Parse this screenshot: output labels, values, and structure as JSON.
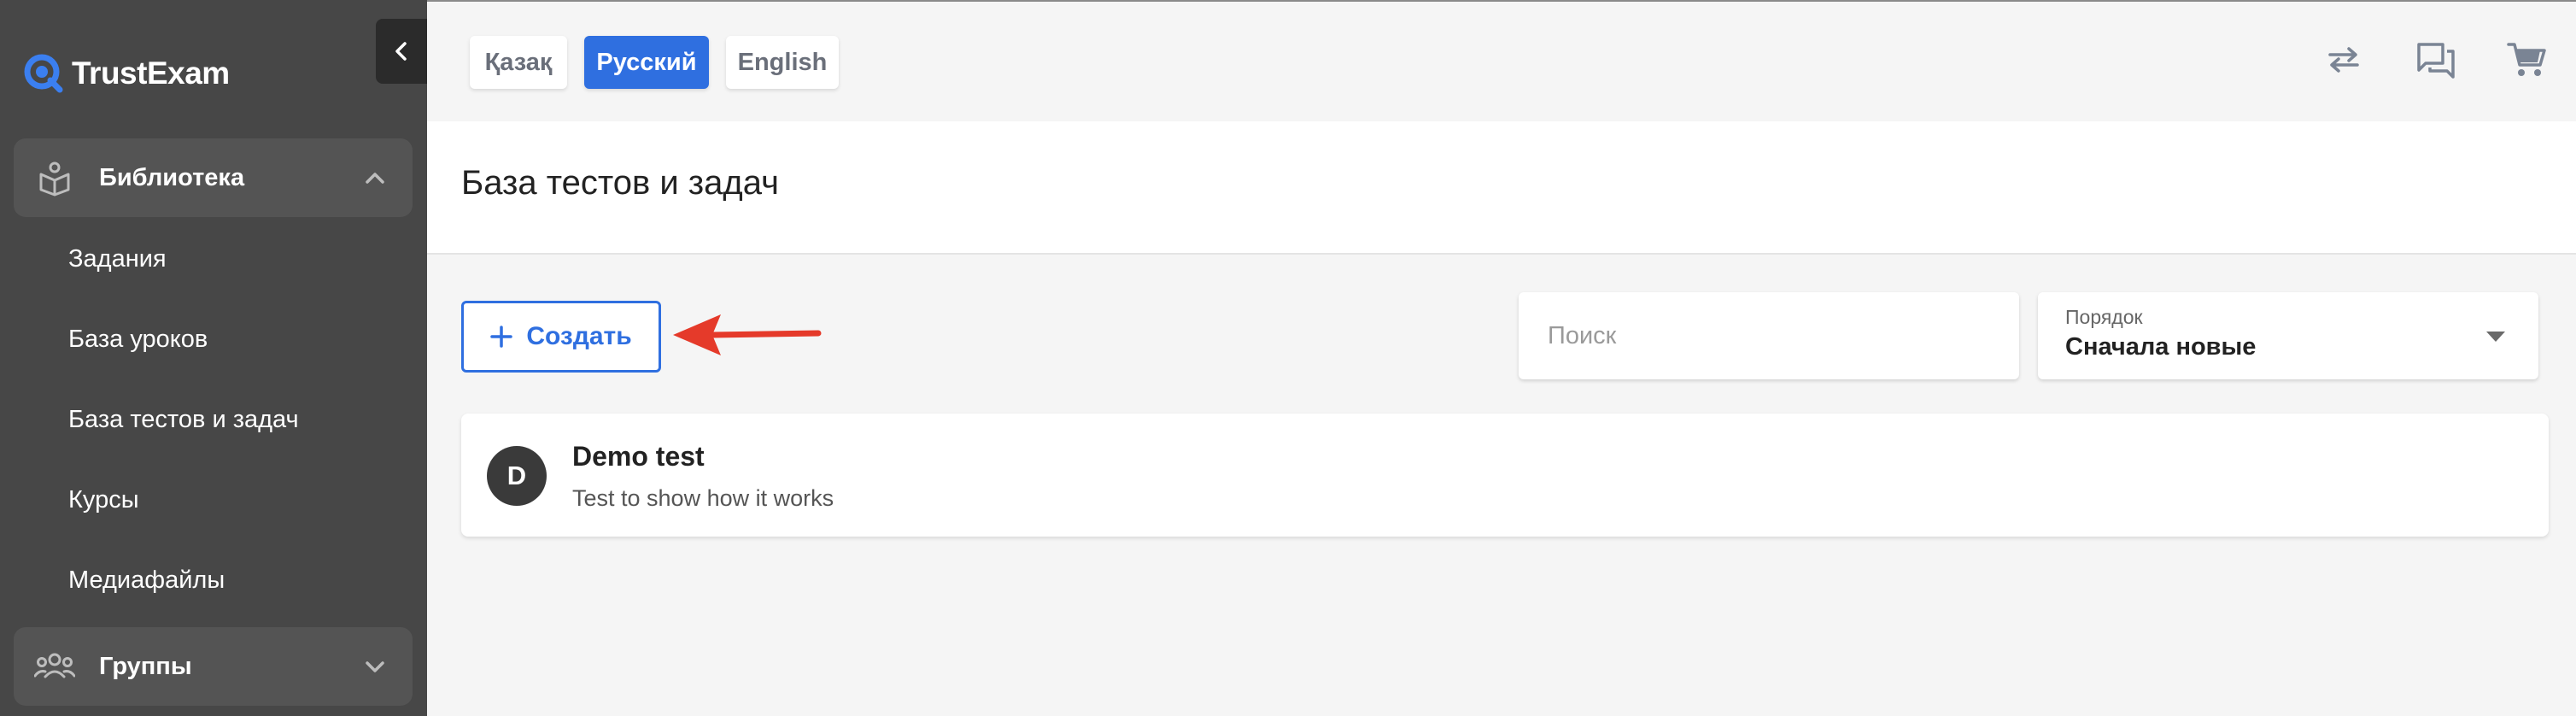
{
  "app": {
    "name": "TrustExam",
    "brand_color": "#2f6fe0"
  },
  "sidebar": {
    "groups": [
      {
        "label": "Библиотека",
        "icon": "library-icon",
        "expanded": true,
        "items": [
          {
            "label": "Задания"
          },
          {
            "label": "База уроков"
          },
          {
            "label": "База тестов и задач"
          },
          {
            "label": "Курсы"
          },
          {
            "label": "Медиафайлы"
          }
        ]
      },
      {
        "label": "Группы",
        "icon": "groups-icon",
        "expanded": false
      }
    ]
  },
  "topbar": {
    "languages": [
      {
        "label": "Қазақ",
        "active": false
      },
      {
        "label": "Русский",
        "active": true
      },
      {
        "label": "English",
        "active": false
      }
    ],
    "icons": [
      "swap-icon",
      "chat-icon",
      "cart-icon"
    ]
  },
  "page": {
    "title": "База тестов и задач"
  },
  "toolbar": {
    "create_label": "Создать",
    "search_placeholder": "Поиск",
    "order_label": "Порядок",
    "order_value": "Сначала новые"
  },
  "tests": [
    {
      "avatar_letter": "D",
      "title": "Demo test",
      "description": "Test to show how it works"
    }
  ],
  "annotation": {
    "arrow_color": "#e53a2a"
  }
}
